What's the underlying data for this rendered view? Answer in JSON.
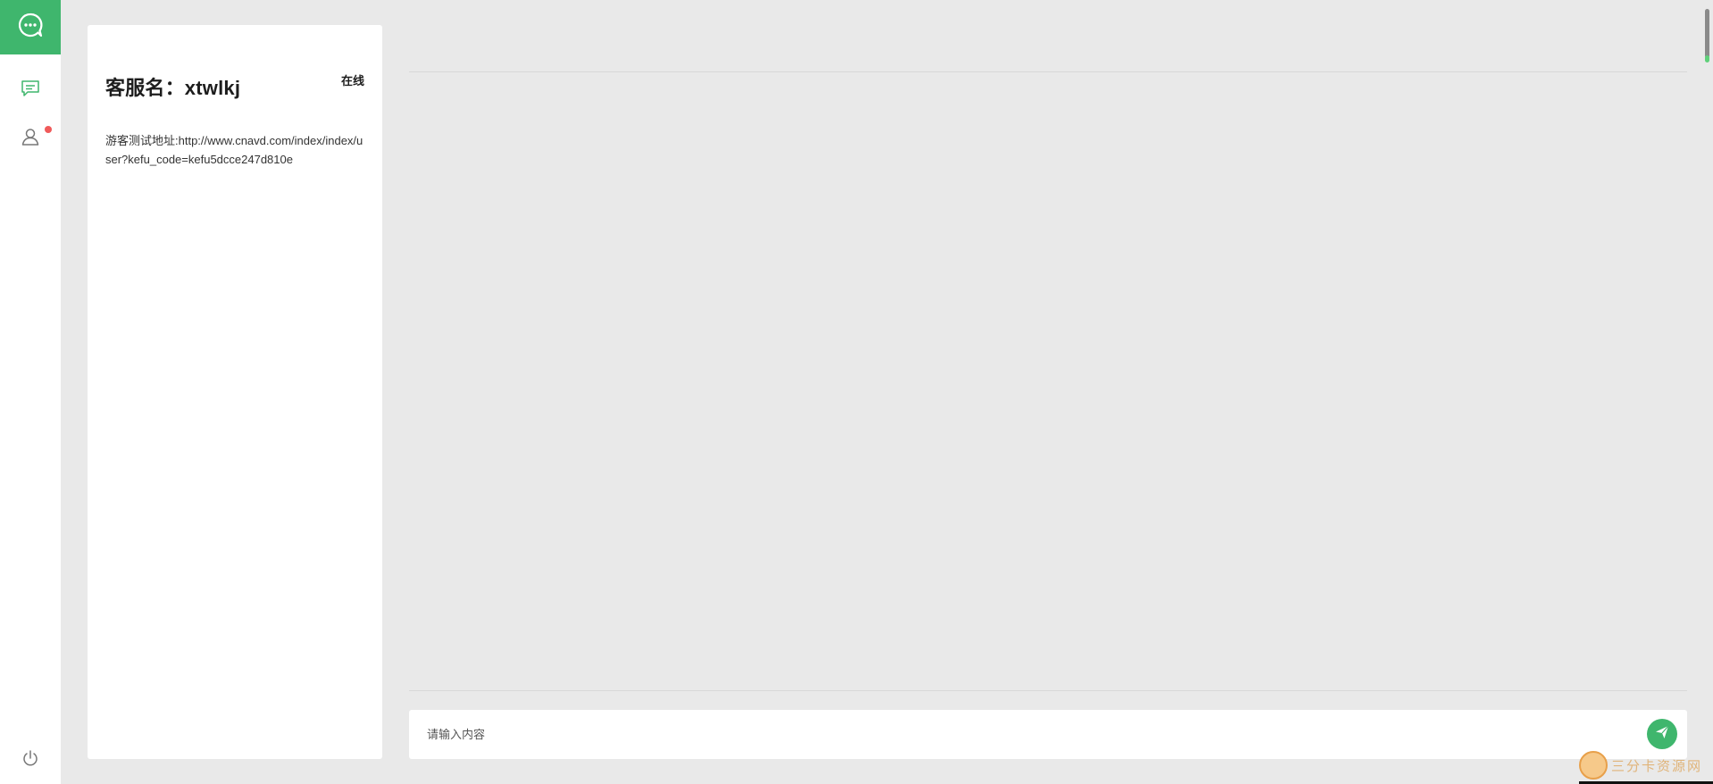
{
  "rail": {
    "logo_icon": "chat-bubble-dots-icon",
    "items": [
      {
        "icon": "message-icon",
        "active": true
      },
      {
        "icon": "user-icon",
        "has_badge": true
      }
    ],
    "bottom_icon": "power-icon",
    "accent_color": "#3fb66d",
    "badge_color": "#f05a5a"
  },
  "card": {
    "title": "客服名：xtwlkj",
    "status": "在线",
    "description": "游客测试地址:http://www.cnavd.com/index/index/user?kefu_code=kefu5dcce247d810e"
  },
  "composer": {
    "placeholder": "请输入内容",
    "value": "",
    "send_icon": "paper-plane-icon"
  },
  "watermark": {
    "text": "三分卡资源网"
  }
}
